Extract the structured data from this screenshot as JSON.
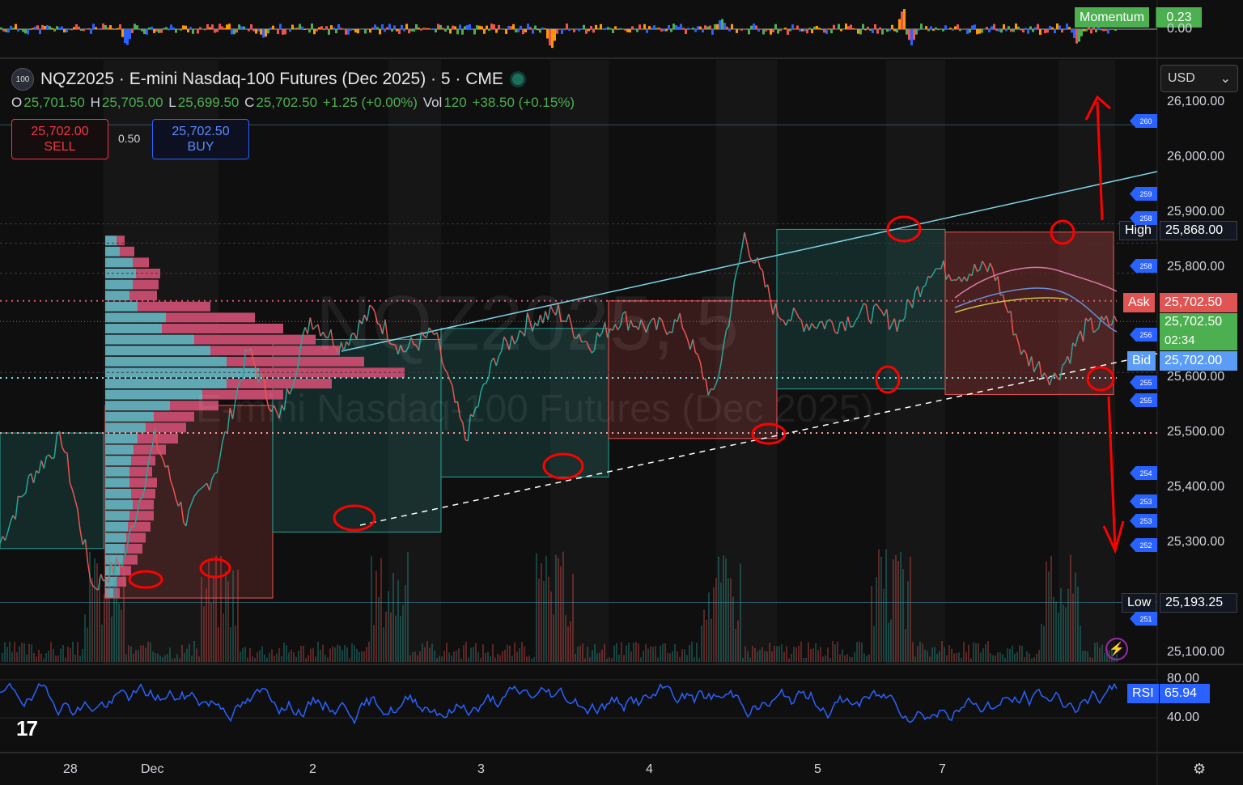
{
  "header": {
    "symbol_badge": "100",
    "title": "NQZ2025 · E-mini Nasdaq-100 Futures (Dec 2025) · 5 · CME",
    "ohlc": {
      "o_label": "O",
      "o": "25,701.50",
      "h_label": "H",
      "h": "25,705.00",
      "l_label": "L",
      "l": "25,699.50",
      "c_label": "C",
      "c": "25,702.50",
      "change": "+1.25 (+0.00%)",
      "vol_label": "Vol",
      "vol": "120",
      "vol_change": "+38.50 (+0.15%)"
    }
  },
  "trade": {
    "sell_price": "25,702.00",
    "sell_label": "SELL",
    "spread": "0.50",
    "buy_price": "25,702.50",
    "buy_label": "BUY"
  },
  "currency": {
    "value": "USD",
    "icon": "chevron-down-icon"
  },
  "momentum": {
    "label": "Momentum",
    "value": "0.23",
    "axis_tick": "0.00"
  },
  "watermark": {
    "line1": "NQZ2025, 5",
    "line2": "E-mini Nasdaq-100 Futures (Dec 2025)"
  },
  "price_labels": {
    "high_label": "High",
    "high_value": "25,868.00",
    "ask_label": "Ask",
    "ask_value": "25,702.50",
    "last_value": "25,702.50",
    "countdown": "02:34",
    "bid_label": "Bid",
    "bid_value": "25,702.00",
    "low_label": "Low",
    "low_value": "25,193.25"
  },
  "rsi": {
    "label": "RSI",
    "value": "65.94",
    "ticks": [
      "80.00",
      "40.00"
    ]
  },
  "bubbles": [
    "260",
    "259",
    "258",
    "258",
    "256",
    "255",
    "255",
    "254",
    "253",
    "253",
    "252",
    "251"
  ],
  "colors": {
    "up": "#26a69a",
    "down": "#ef5350",
    "annotation": "#ff0000",
    "rsi": "#2962ff",
    "accent_green": "#4caf50"
  },
  "logo_text": "17",
  "chart_data": {
    "type": "line",
    "title": "NQZ2025 · E-mini Nasdaq-100 Futures (Dec 2025) · 5 · CME",
    "x": [
      "28",
      "Dec",
      "2",
      "3",
      "4",
      "5",
      "7"
    ],
    "ylim": [
      25050,
      26130
    ],
    "y_ticks": [
      26100,
      26000,
      25900,
      25800,
      25700,
      25600,
      25500,
      25400,
      25300,
      25100
    ],
    "y_tick_labels": [
      "26,100.00",
      "26,000.00",
      "25,900.00",
      "25,800.00",
      "25,700.00",
      "25,600.00",
      "25,500.00",
      "25,400.00",
      "25,300.00",
      "25,100.00"
    ],
    "series": [
      {
        "values": [
          25300,
          25420,
          25490,
          25220,
          25270,
          25490,
          25340,
          25440,
          25650,
          25520,
          25710,
          25660,
          25720,
          25650,
          25680,
          25490,
          25640,
          25700,
          25720,
          25660,
          25710,
          25690,
          25700,
          25560,
          25860,
          25720,
          25700,
          25700,
          25720,
          25700,
          25800,
          25790,
          25800,
          25640,
          25600,
          25690,
          25702.5
        ]
      }
    ],
    "high": 25868.0,
    "low": 25193.25,
    "ask": 25702.5,
    "bid": 25702.0,
    "rsi_last": 65.94,
    "grid": false
  }
}
